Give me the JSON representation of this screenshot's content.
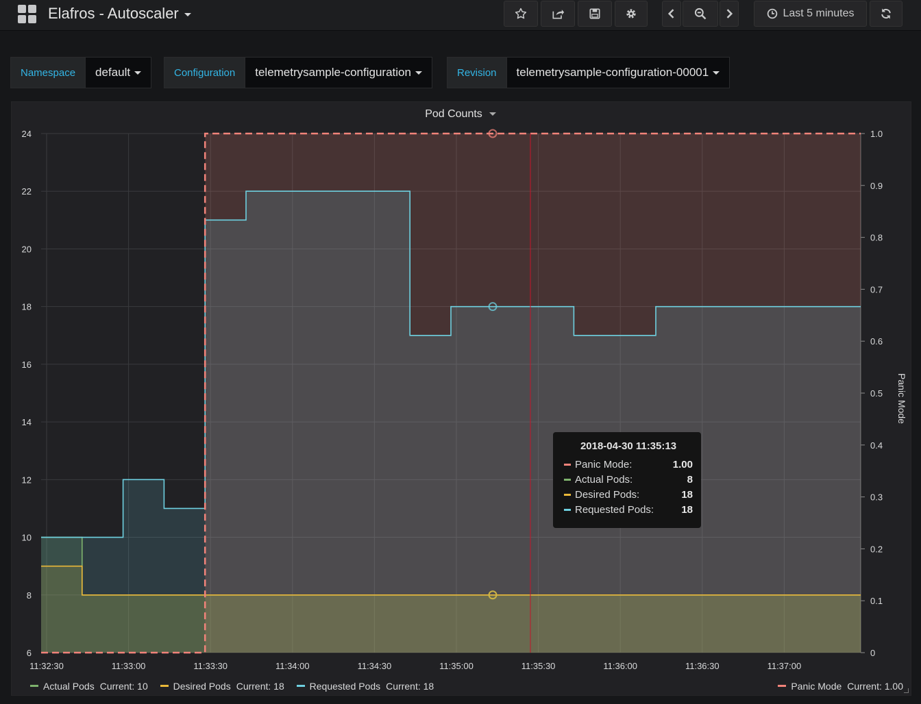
{
  "header": {
    "title": "Elafros - Autoscaler",
    "time_range": "Last 5 minutes"
  },
  "variables": [
    {
      "label": "Namespace",
      "value": "default"
    },
    {
      "label": "Configuration",
      "value": "telemetrysample-configuration"
    },
    {
      "label": "Revision",
      "value": "telemetrysample-configuration-00001"
    }
  ],
  "panel": {
    "title": "Pod Counts"
  },
  "tooltip": {
    "time": "2018-04-30 11:35:13",
    "rows": [
      {
        "name": "Panic Mode:",
        "value": "1.00",
        "color": "#f2837a"
      },
      {
        "name": "Actual Pods:",
        "value": "8",
        "color": "#7eb26d"
      },
      {
        "name": "Desired Pods:",
        "value": "18",
        "color": "#eab839"
      },
      {
        "name": "Requested Pods:",
        "value": "18",
        "color": "#6ed0e0"
      }
    ]
  },
  "legend": [
    {
      "name": "Actual Pods",
      "current": "Current: 10",
      "color": "#7eb26d"
    },
    {
      "name": "Desired Pods",
      "current": "Current: 18",
      "color": "#eab839"
    },
    {
      "name": "Requested Pods",
      "current": "Current: 18",
      "color": "#6ed0e0"
    }
  ],
  "legend_right": {
    "name": "Panic Mode",
    "current": "Current: 1.00",
    "color": "#f2837a"
  },
  "chart_data": {
    "type": "line",
    "title": "Pod Counts",
    "y_left": {
      "range": [
        6,
        24
      ],
      "ticks": [
        "6",
        "8",
        "10",
        "12",
        "14",
        "16",
        "18",
        "20",
        "22",
        "24"
      ]
    },
    "y_right": {
      "label": "Panic Mode",
      "range": [
        0,
        1
      ],
      "ticks": [
        "0",
        "0.1",
        "0.2",
        "0.3",
        "0.4",
        "0.5",
        "0.6",
        "0.7",
        "0.8",
        "0.9",
        "1.0"
      ]
    },
    "x_range": [
      "11:32:30",
      "11:37:30"
    ],
    "x_ticks": [
      "11:32:30",
      "11:33:00",
      "11:33:30",
      "11:34:00",
      "11:34:30",
      "11:35:00",
      "11:35:30",
      "11:36:00",
      "11:36:30",
      "11:37:00"
    ],
    "grid": true,
    "legend_position": "bottom",
    "hover_time": "11:35:13",
    "series": [
      {
        "name": "Actual Pods",
        "axis": "left",
        "color": "#7eb26d",
        "step": true,
        "x": [
          "11:32:30",
          "11:32:45",
          "11:33:30",
          "11:37:30"
        ],
        "y": [
          10,
          8,
          8,
          8
        ]
      },
      {
        "name": "Desired Pods",
        "axis": "left",
        "color": "#eab839",
        "step": true,
        "x": [
          "11:32:30",
          "11:32:45",
          "11:33:30",
          "11:37:30"
        ],
        "y": [
          9,
          8,
          8,
          8
        ]
      },
      {
        "name": "Requested Pods",
        "axis": "left",
        "color": "#6ed0e0",
        "step": true,
        "x": [
          "11:32:30",
          "11:32:45",
          "11:33:00",
          "11:33:15",
          "11:33:30",
          "11:33:45",
          "11:34:45",
          "11:35:00",
          "11:35:45",
          "11:36:15",
          "11:37:30"
        ],
        "y": [
          10,
          10,
          12,
          11,
          21,
          22,
          17,
          18,
          17,
          18,
          18
        ]
      },
      {
        "name": "Panic Mode",
        "axis": "right",
        "color": "#f2837a",
        "step": true,
        "dashed": true,
        "x": [
          "11:32:30",
          "11:33:30",
          "11:37:30"
        ],
        "y": [
          0,
          1,
          1
        ]
      }
    ]
  }
}
